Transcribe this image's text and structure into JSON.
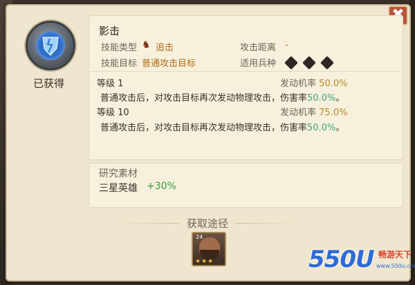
{
  "close_label": "✖",
  "emblem": {
    "icon": "shattered-shield-icon"
  },
  "status": {
    "obtained": "已获得"
  },
  "skill": {
    "name": "影击",
    "type_label": "技能类型",
    "type_value": "追击",
    "type_icon": "pursuit-icon",
    "range_label": "攻击距离",
    "range_value": "-",
    "target_label": "技能目标",
    "target_value": "普通攻击目标",
    "troop_label": "适用兵种",
    "troop_icons": [
      "infantry-icon",
      "shield-troop-icon",
      "cavalry-icon"
    ]
  },
  "levels": [
    {
      "level": "等级 1",
      "rate_label": "发动机率",
      "rate_value": "50.0%",
      "desc_prefix": "普通攻击后，对攻击目标再次发动物理攻击，伤害率",
      "desc_pct": "50.0%",
      "desc_suffix": "。"
    },
    {
      "level": "等级 10",
      "rate_label": "发动机率",
      "rate_value": "75.0%",
      "desc_prefix": "普通攻击后，对攻击目标再次发动物理攻击，伤害率",
      "desc_pct": "50.0%",
      "desc_suffix": "。"
    }
  ],
  "research": {
    "title": "研究素材",
    "item": "三星英雄",
    "bonus": "+30%"
  },
  "acquire": {
    "title": "获取途径",
    "hero_level": "24",
    "hero_stars": "★★★"
  },
  "watermark": {
    "logo": "550U",
    "name": "畅游天下",
    "url": "www.550u.com"
  },
  "colors": {
    "accent_gold": "#b48a2a",
    "accent_green": "#3aa77b",
    "type_orange": "#b06c1c"
  }
}
